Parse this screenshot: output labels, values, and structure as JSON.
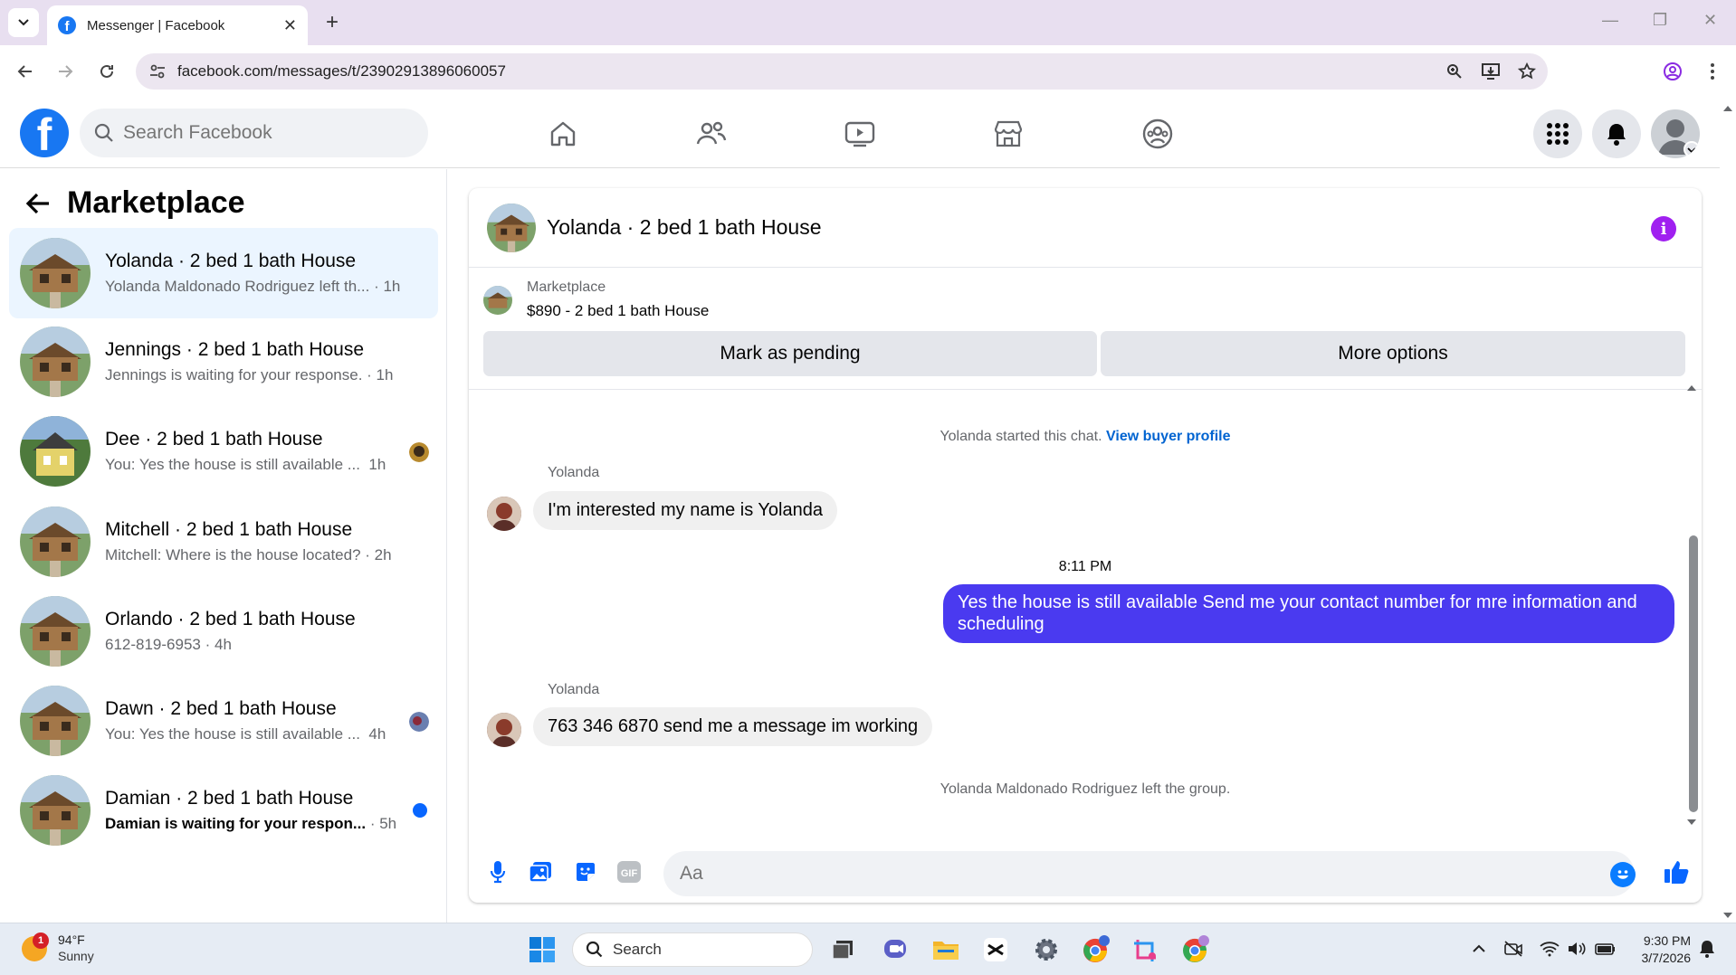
{
  "browser": {
    "tab_title": "Messenger | Facebook",
    "url": "facebook.com/messages/t/23902913896060057"
  },
  "header": {
    "search_placeholder": "Search Facebook"
  },
  "sidebar": {
    "title": "Marketplace",
    "conversations": [
      {
        "name": "Yolanda · 2 bed 1 bath House",
        "preview": "Yolanda Maldonado Rodriguez left th...",
        "time": "· 1h",
        "active": true
      },
      {
        "name": "Jennings · 2 bed 1 bath House",
        "preview": "Jennings is waiting for your response.",
        "time": "· 1h"
      },
      {
        "name": "Dee · 2 bed 1 bath House",
        "preview": "You: Yes the house is still available ...",
        "time": "1h"
      },
      {
        "name": "Mitchell · 2 bed 1 bath House",
        "preview": "Mitchell: Where is the house located?",
        "time": "· 2h"
      },
      {
        "name": "Orlando · 2 bed 1 bath House",
        "preview": "612-819-6953",
        "time": "· 4h"
      },
      {
        "name": "Dawn · 2 bed 1 bath House",
        "preview": "You: Yes the house is still available ...",
        "time": "4h"
      },
      {
        "name": "Damian · 2 bed 1 bath House",
        "preview": "Damian is waiting for your respon...",
        "time": "· 5h",
        "unread": true
      }
    ]
  },
  "chat": {
    "title": "Yolanda · 2 bed 1 bath House",
    "marketplace_label": "Marketplace",
    "listing": "$890 - 2 bed 1 bath House",
    "mark_pending": "Mark as pending",
    "more_options": "More options",
    "started_text": "Yolanda started this chat.",
    "view_profile": "View buyer profile",
    "messages": [
      {
        "sender": "Yolanda",
        "text": "I'm interested my name is Yolanda"
      },
      {
        "timestamp": "8:11 PM"
      },
      {
        "sender": "You",
        "text": "Yes the house is still available  Send me your contact number for mre information and  scheduling"
      },
      {
        "sender": "Yolanda",
        "text": "763 346 6870 send me a message im working"
      }
    ],
    "left_text": "Yolanda Maldonado Rodriguez left the group.",
    "composer_placeholder": "Aa"
  },
  "taskbar": {
    "temp": "94°F",
    "condition": "Sunny",
    "weather_badge": "1",
    "search_label": "Search",
    "time": "9:30 PM",
    "date": "3/7/2026"
  },
  "colors": {
    "accent": "#1877f2",
    "outgoing_bubble": "#4a3af0",
    "info_icon": "#a020f0"
  }
}
